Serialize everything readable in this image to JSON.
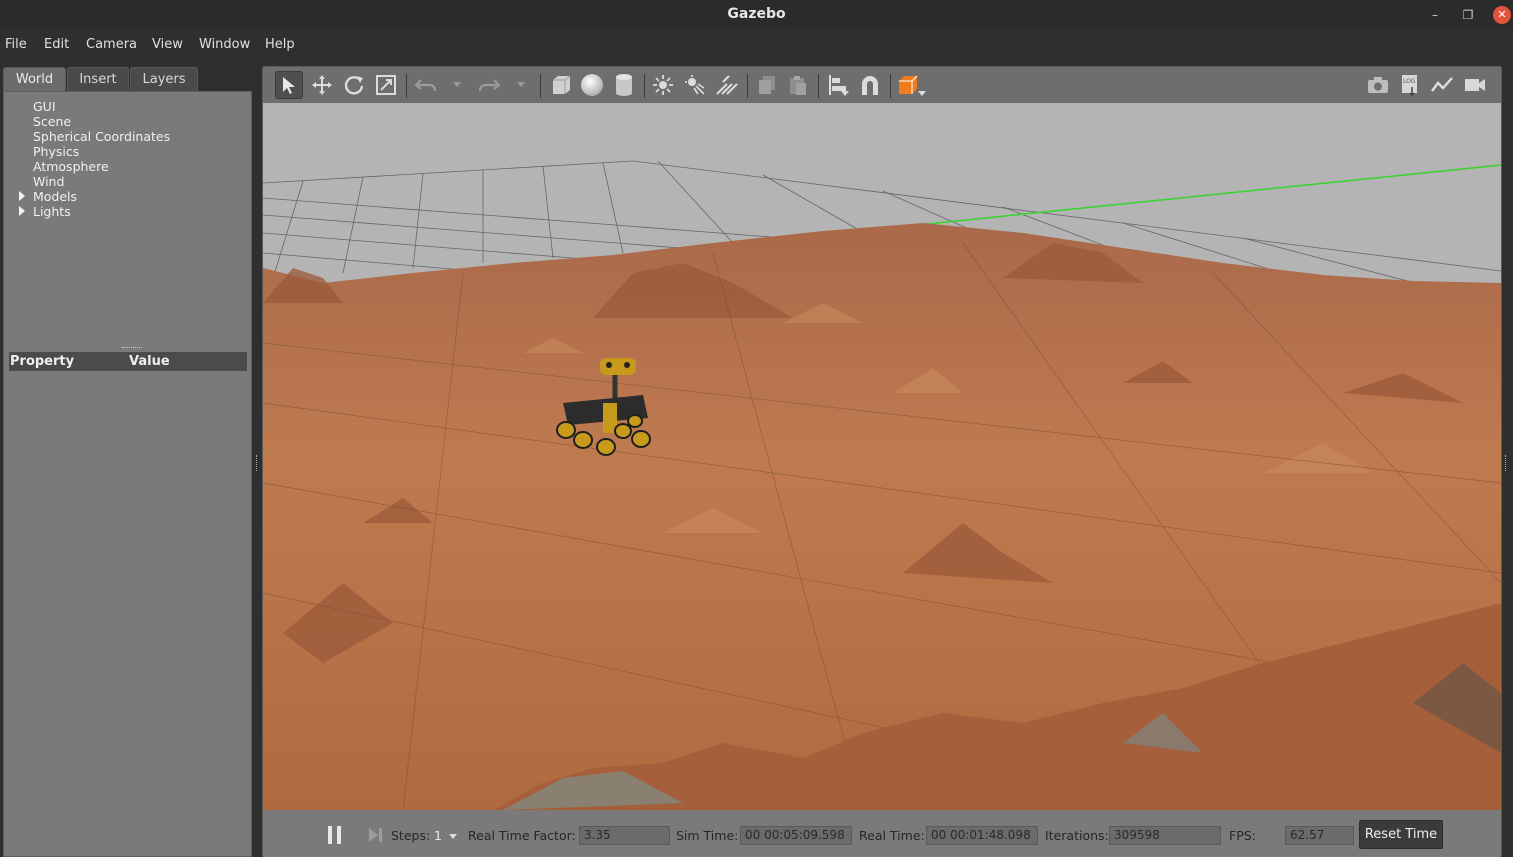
{
  "window": {
    "title": "Gazebo"
  },
  "menu": [
    "File",
    "Edit",
    "Camera",
    "View",
    "Window",
    "Help"
  ],
  "left_panel": {
    "tabs": [
      "World",
      "Insert",
      "Layers"
    ],
    "active_tab": "World",
    "tree": [
      {
        "label": "GUI",
        "expandable": false
      },
      {
        "label": "Scene",
        "expandable": false
      },
      {
        "label": "Spherical Coordinates",
        "expandable": false
      },
      {
        "label": "Physics",
        "expandable": false
      },
      {
        "label": "Atmosphere",
        "expandable": false
      },
      {
        "label": "Wind",
        "expandable": false
      },
      {
        "label": "Models",
        "expandable": true
      },
      {
        "label": "Lights",
        "expandable": true
      }
    ],
    "property_header": {
      "property": "Property",
      "value": "Value"
    }
  },
  "toolbar": {
    "tools": [
      "select-mode",
      "translate-mode",
      "rotate-mode",
      "scale-mode",
      "undo",
      "redo",
      "box-shape",
      "sphere-shape",
      "cylinder-shape",
      "point-light",
      "spot-light",
      "directional-light",
      "copy",
      "paste",
      "align",
      "snap",
      "view-angle"
    ],
    "right_tools": [
      "screenshot",
      "log",
      "plot",
      "video-record"
    ],
    "accent": "#f07c1e"
  },
  "bottom_bar": {
    "steps_label": "Steps:",
    "steps_value": "1",
    "rtf_label": "Real Time Factor:",
    "rtf_value": "3.35",
    "sim_time_label": "Sim Time:",
    "sim_time_value": "00 00:05:09.598",
    "real_time_label": "Real Time:",
    "real_time_value": "00 00:01:48.098",
    "iterations_label": "Iterations:",
    "iterations_value": "309598",
    "fps_label": "FPS:",
    "fps_value": "62.57",
    "reset_label": "Reset Time"
  },
  "colors": {
    "terrain": "#b8744a",
    "sky": "#b3b3b3",
    "grid": "#5c5c5c",
    "axis_green": "#35d629"
  }
}
